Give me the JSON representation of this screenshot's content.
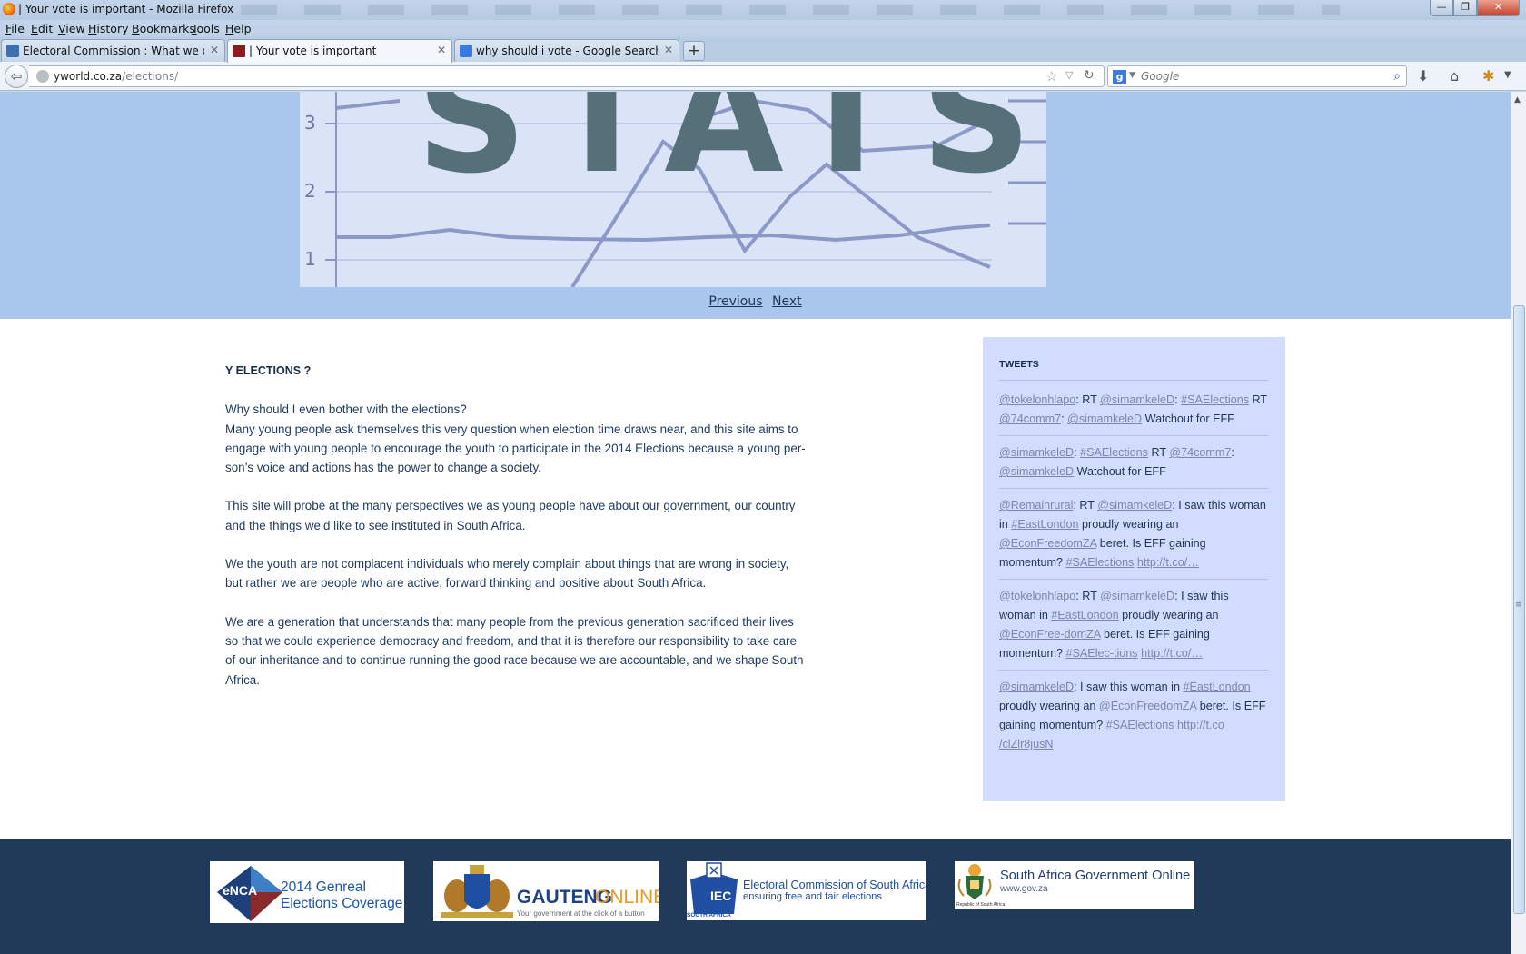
{
  "window": {
    "title": "| Your vote is important - Mozilla Firefox",
    "minimize_glyph": "—",
    "maximize_glyph": "❐",
    "close_glyph": "✕"
  },
  "menu": [
    "File",
    "Edit",
    "View",
    "History",
    "Bookmarks",
    "Tools",
    "Help"
  ],
  "tabs": [
    {
      "label": "Electoral Commission : What we do",
      "active": false,
      "icon": "electoral-commission-favicon"
    },
    {
      "label": "| Your vote is important",
      "active": true,
      "icon": "site-favicon"
    },
    {
      "label": "why should i vote - Google Search",
      "active": false,
      "icon": "google-favicon"
    }
  ],
  "new_tab_glyph": "+",
  "close_tab_glyph": "✕",
  "address": {
    "host": "yworld.co.za",
    "path": "/elections/"
  },
  "search": {
    "engine_glyph": "g",
    "placeholder": "Google"
  },
  "hero": {
    "stats_word": "STATS",
    "ticks": [
      "3",
      "2",
      "1"
    ],
    "prev_label": "Previous",
    "next_label": "Next"
  },
  "article": {
    "heading": "Y ELECTIONS ?",
    "paragraphs": [
      "Why should I even bother with the elections?\nMany young people ask themselves this very question when election time draws near, and this site aims to engage with young people to encourage the youth to participate in the 2014 Elections because a young per-son’s voice and actions has the power to change a society.",
      "This site will probe at the many perspectives we as young people have about our government, our country and the things we’d like to see instituted in South Africa.",
      "We the youth are not complacent individuals who merely complain about things that are wrong in society, but rather we are people who are active, forward thinking and positive about South Africa.",
      "We are a generation that understands that many people from the previous generation sacrificed their lives so that we could experience democracy and freedom, and that it is therefore our responsibility to take care of our inheritance and to continue running the good race because we are accountable, and we shape South Africa."
    ]
  },
  "tweets": {
    "heading": "TWEETS",
    "items": [
      "<a>@tokelonhlapo</a>: RT <a>@simamkeleD</a>: <a>#SAElections</a> RT <a>@74comm7</a>: <a>@simamkeleD</a> Watchout for EFF",
      "<a>@simamkeleD</a>: <a>#SAElections</a> RT <a>@74comm7</a>: <a>@simamkeleD</a> Watchout for EFF",
      "<a>@Remainrural</a>: RT <a>@simamkeleD</a>: I saw this woman in <a>#EastLondon</a> proudly wearing an <a>@EconFreedomZA</a> beret. Is EFF gaining momentum? <a>#SAElections</a> <a>http://t.co/…</a>",
      "<a>@tokelonhlapo</a>: RT <a>@simamkeleD</a>: I saw this woman in <a>#EastLondon</a> proudly wearing an <a>@EconFree-domZA</a> beret. Is EFF gaining momentum? <a>#SAElec-tions</a> <a>http://t.co/…</a>",
      "<a>@simamkeleD</a>: I saw this woman in <a>#EastLondon</a> proudly wearing an <a>@EconFreedomZA</a> beret. Is EFF gaining momentum? <a>#SAElections</a> <a>http://t.co /clZlr8jusN</a>"
    ]
  },
  "footer_logos": {
    "enca": {
      "brand": "eNCA",
      "line1": "2014 Genreal",
      "line2": "Elections Coverage"
    },
    "gauteng": {
      "brand_a": "GAUTENG",
      "brand_b": "ONLINE",
      "tagline": "Your government at the click of a button"
    },
    "iec": {
      "badge": "IEC",
      "line1": "Electoral Commission of South Africa",
      "line2": "ensuring free and fair elections",
      "country": "SOUTH AFRICA"
    },
    "gov": {
      "line1": "South Africa Government Online",
      "line2": "www.gov.za",
      "caption": "Republic of South Africa"
    }
  },
  "colors": {
    "hero_bg": "#a9c7ec",
    "tweets_bg": "#d2dcff",
    "footer_bg": "#213a5a",
    "text": "#1f3a5f"
  }
}
